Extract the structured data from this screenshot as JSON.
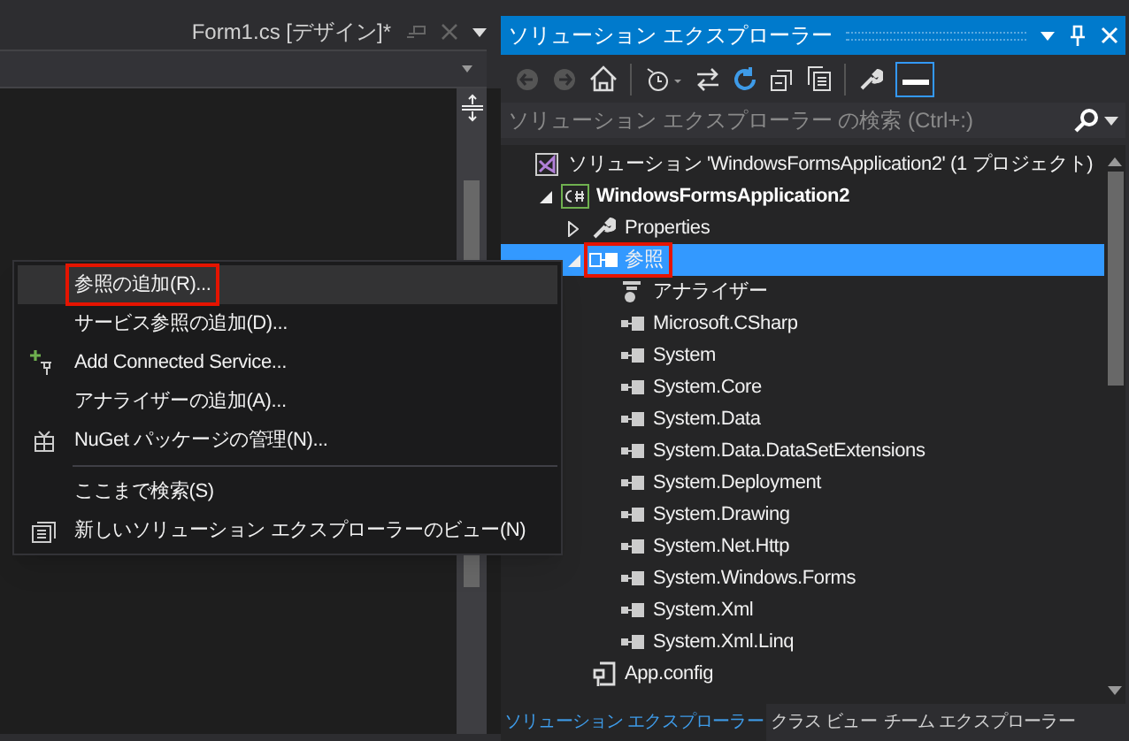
{
  "document_tab": {
    "title": "Form1.cs [デザイン]*"
  },
  "context_menu": [
    {
      "kind": "item",
      "label": "参照の追加(R)...",
      "selected": true,
      "marked": true
    },
    {
      "kind": "item",
      "label": "サービス参照の追加(D)...",
      "selected": false,
      "marked": false
    },
    {
      "kind": "connected-service",
      "label": "Add Connected Service...",
      "selected": false,
      "marked": false
    },
    {
      "kind": "item",
      "label": "アナライザーの追加(A)...",
      "selected": false,
      "marked": false
    },
    {
      "kind": "package",
      "label": "NuGet パッケージの管理(N)...",
      "selected": false,
      "marked": false
    },
    {
      "kind": "separator"
    },
    {
      "kind": "item",
      "label": "ここまで検索(S)",
      "selected": false,
      "marked": false
    },
    {
      "kind": "view",
      "label": "新しいソリューション エクスプローラーのビュー(N)",
      "selected": false,
      "marked": false
    }
  ],
  "solution_explorer": {
    "title": "ソリューション エクスプローラー",
    "search": {
      "placeholder": "ソリューション エクスプローラー の検索 (Ctrl+:)"
    },
    "tree": [
      {
        "kind": "solution",
        "label": "ソリューション 'WindowsFormsApplication2' (1 プロジェクト)",
        "selected": false,
        "marked": false,
        "children": [
          {
            "kind": "project",
            "label": "WindowsFormsApplication2",
            "expanded": true,
            "selected": false,
            "marked": false,
            "children": [
              {
                "kind": "properties",
                "label": "Properties",
                "expanded": false,
                "selected": false,
                "marked": false
              },
              {
                "kind": "references",
                "label": "参照",
                "expanded": true,
                "selected": true,
                "marked": true,
                "children": [
                  {
                    "kind": "analyzer",
                    "label": "アナライザー",
                    "selected": false,
                    "marked": false
                  },
                  {
                    "kind": "reference",
                    "label": "Microsoft.CSharp",
                    "selected": false,
                    "marked": false
                  },
                  {
                    "kind": "reference",
                    "label": "System",
                    "selected": false,
                    "marked": false
                  },
                  {
                    "kind": "reference",
                    "label": "System.Core",
                    "selected": false,
                    "marked": false
                  },
                  {
                    "kind": "reference",
                    "label": "System.Data",
                    "selected": false,
                    "marked": false
                  },
                  {
                    "kind": "reference",
                    "label": "System.Data.DataSetExtensions",
                    "selected": false,
                    "marked": false
                  },
                  {
                    "kind": "reference",
                    "label": "System.Deployment",
                    "selected": false,
                    "marked": false
                  },
                  {
                    "kind": "reference",
                    "label": "System.Drawing",
                    "selected": false,
                    "marked": false
                  },
                  {
                    "kind": "reference",
                    "label": "System.Net.Http",
                    "selected": false,
                    "marked": false
                  },
                  {
                    "kind": "reference",
                    "label": "System.Windows.Forms",
                    "selected": false,
                    "marked": false
                  },
                  {
                    "kind": "reference",
                    "label": "System.Xml",
                    "selected": false,
                    "marked": false
                  },
                  {
                    "kind": "reference",
                    "label": "System.Xml.Linq",
                    "selected": false,
                    "marked": false
                  }
                ]
              },
              {
                "kind": "config",
                "label": "App.config",
                "selected": false,
                "marked": false
              }
            ]
          }
        ]
      }
    ],
    "bottom_tabs": [
      {
        "label": "ソリューション エクスプローラー",
        "selected": true
      },
      {
        "label": "クラス ビュー",
        "selected": false
      },
      {
        "label": "チーム エクスプローラー",
        "selected": false
      }
    ]
  }
}
